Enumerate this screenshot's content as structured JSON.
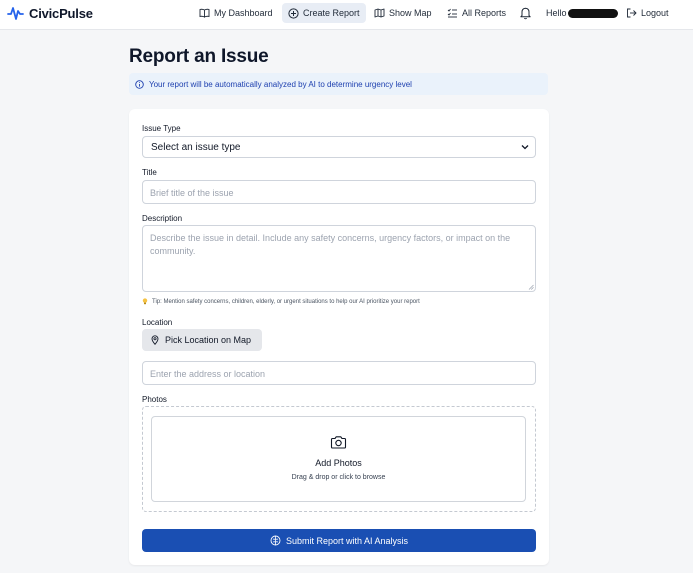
{
  "header": {
    "brand": "CivicPulse",
    "nav": [
      {
        "label": "My Dashboard",
        "icon": "book-icon"
      },
      {
        "label": "Create Report",
        "icon": "plus-circle-icon",
        "active": true
      },
      {
        "label": "Show Map",
        "icon": "map-icon"
      },
      {
        "label": "All Reports",
        "icon": "list-check-icon"
      }
    ],
    "notifications_icon": "bell-icon",
    "greeting": "Hello",
    "logout": "Logout"
  },
  "page": {
    "title": "Report an Issue",
    "info_banner": "Your report will be automatically analyzed by AI to determine urgency level"
  },
  "form": {
    "issue_type": {
      "label": "Issue Type",
      "selected": "Select an issue type"
    },
    "title": {
      "label": "Title",
      "placeholder": "Brief title of the issue"
    },
    "description": {
      "label": "Description",
      "placeholder": "Describe the issue in detail. Include any safety concerns, urgency factors, or impact on the community."
    },
    "tip": "Tip: Mention safety concerns, children, elderly, or urgent situations to help our AI prioritize your report",
    "location": {
      "label": "Location",
      "pick_button": "Pick Location on Map",
      "placeholder": "Enter the address or location"
    },
    "photos": {
      "label": "Photos",
      "title": "Add Photos",
      "hint": "Drag & drop or click to browse"
    },
    "submit": "Submit Report with AI Analysis"
  },
  "colors": {
    "primary": "#1a4fb3",
    "banner_bg": "#eaf2fb",
    "banner_text": "#1e40af",
    "brand_icon": "#2563eb"
  }
}
